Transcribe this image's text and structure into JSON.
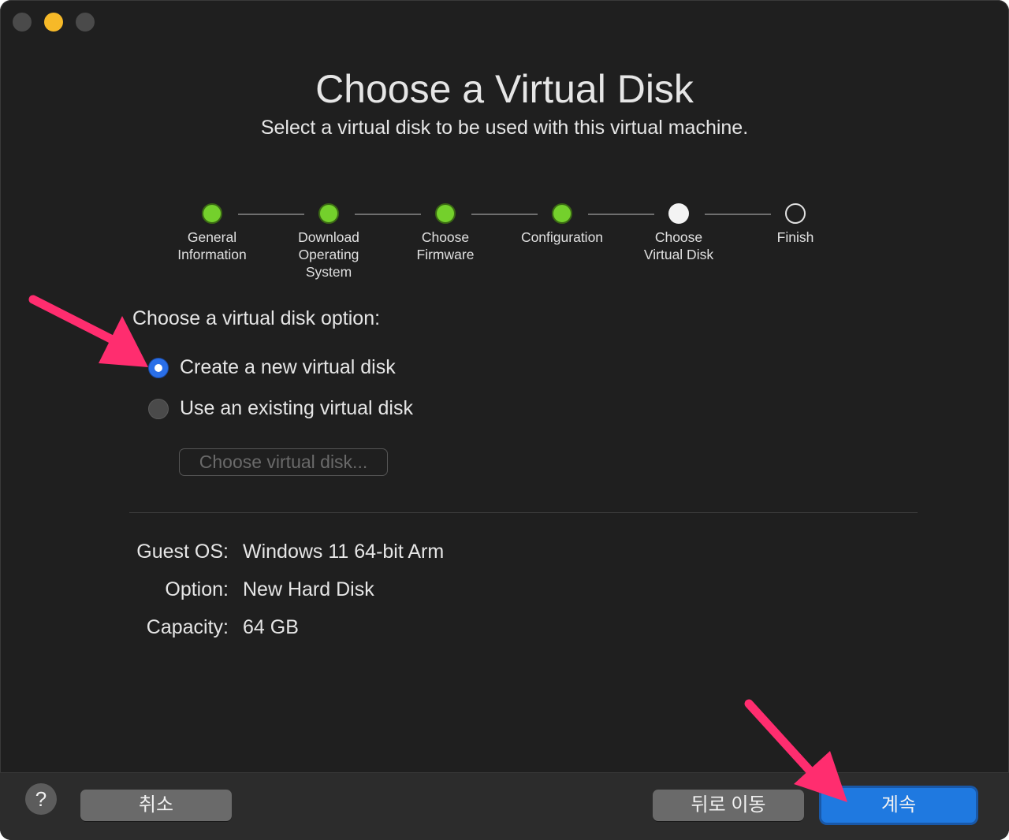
{
  "window": {
    "title": "Choose a Virtual Disk",
    "subtitle": "Select a virtual disk to be used with this virtual machine."
  },
  "steps": [
    {
      "lines": [
        "General",
        "Information"
      ],
      "state": "done"
    },
    {
      "lines": [
        "Download",
        "Operating",
        "System"
      ],
      "state": "done"
    },
    {
      "lines": [
        "Choose",
        "Firmware"
      ],
      "state": "done"
    },
    {
      "lines": [
        "Configuration"
      ],
      "state": "done"
    },
    {
      "lines": [
        "Choose",
        "Virtual Disk"
      ],
      "state": "current"
    },
    {
      "lines": [
        "Finish"
      ],
      "state": "todo"
    }
  ],
  "disk_options": {
    "prompt": "Choose a virtual disk option:",
    "create_new": {
      "label": "Create a new virtual disk",
      "selected": true
    },
    "use_existing": {
      "label": "Use an existing virtual disk",
      "selected": false
    },
    "choose_button": "Choose virtual disk..."
  },
  "summary": {
    "guest_os_label": "Guest OS:",
    "guest_os_value": "Windows 11 64-bit Arm",
    "option_label": "Option:",
    "option_value": "New Hard Disk",
    "capacity_label": "Capacity:",
    "capacity_value": "64 GB"
  },
  "footer": {
    "help": "?",
    "cancel": "취소",
    "back": "뒤로 이동",
    "continue": "계속"
  },
  "colors": {
    "accent": "#1f79e0",
    "step_done": "#74d02c",
    "annotation_arrow": "#ff2d6f"
  }
}
